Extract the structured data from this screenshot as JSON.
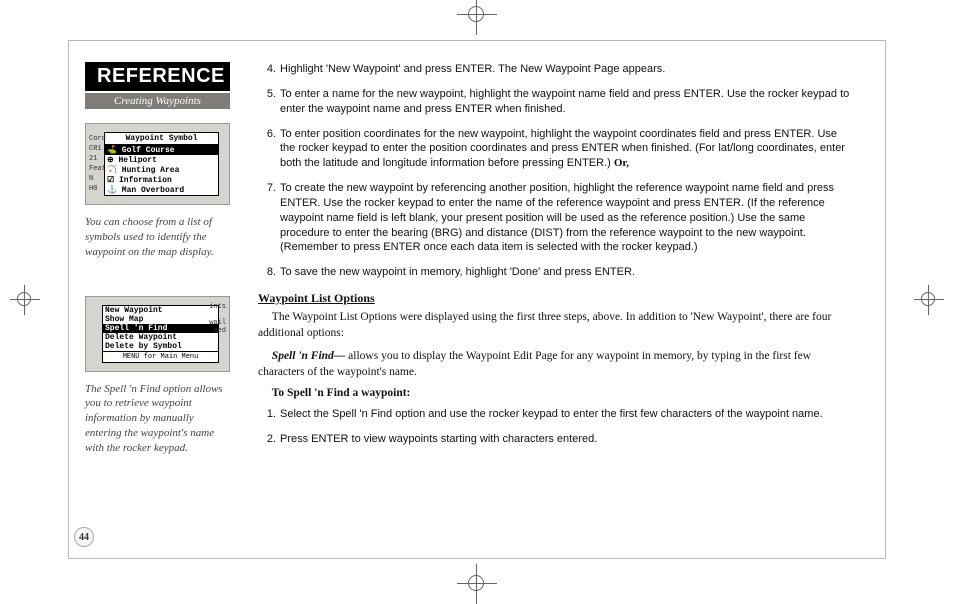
{
  "banner": "REFERENCE",
  "subhead": "Creating Waypoints",
  "screenshot1": {
    "title": "Waypoint Symbol",
    "sidetext": "Cord\nCR1\n21\nFeat\nN\nH0",
    "rows": [
      {
        "text": "⛳ Golf Course",
        "selected": true
      },
      {
        "text": "⊕ Heliport",
        "selected": false
      },
      {
        "text": "🏹 Hunting Area",
        "selected": false
      },
      {
        "text": "☑ Information",
        "selected": false
      },
      {
        "text": "⚓ Man Overboard",
        "selected": false
      }
    ]
  },
  "caption1": "You can choose from a list of symbols used to identify the waypoint on the map display.",
  "screenshot2": {
    "rows": [
      {
        "text": "New Waypoint",
        "selected": false
      },
      {
        "text": "Show Map",
        "selected": false
      },
      {
        "text": "Spell 'n Find",
        "selected": true
      },
      {
        "text": "Delete Waypoint",
        "selected": false
      },
      {
        "text": "Delete by Symbol",
        "selected": false
      }
    ],
    "footer": "MENU for Main Menu",
    "sideright": "ints\n\nwail\nsed"
  },
  "caption2": "The Spell 'n Find option allows you to retrieve waypoint information by manually entering the waypoint's name with the rocker keypad.",
  "steps": [
    {
      "n": "4.",
      "t": "Highlight 'New Waypoint' and press ENTER. The New Waypoint Page appears."
    },
    {
      "n": "5.",
      "t": "To enter a name for the new waypoint, highlight the waypoint name field and press ENTER. Use the rocker keypad to enter the waypoint name and press ENTER when finished."
    },
    {
      "n": "6.",
      "t": "To enter position coordinates for the new waypoint, highlight the waypoint coordinates field and press ENTER. Use the rocker keypad to enter the position coordinates and press ENTER when finished. (For lat/long coordinates, enter both the latitude and longitude information before pressing ENTER.) ",
      "or": "Or,"
    },
    {
      "n": "7.",
      "t": "To create the new waypoint by referencing another position, highlight the reference waypoint name field and press ENTER. Use the rocker keypad to enter the name of the reference waypoint and press ENTER. (If the reference waypoint name field is left blank, your present position will be used as the reference position.) Use the same procedure to enter the bearing (BRG) and distance (DIST) from the reference waypoint to the new waypoint. (Remember to press ENTER once each data item is selected with the rocker keypad.)"
    },
    {
      "n": "8.",
      "t": "To save the new waypoint in memory, highlight 'Done' and press ENTER."
    }
  ],
  "sectionTitle": "Waypoint List Options",
  "sectionBody1": "The Waypoint List Options were displayed using the first three steps, above. In addition to 'New Waypoint', there are four additional options:",
  "spellLead": "Spell 'n Find—",
  "spellBody": " allows you to display the Waypoint Edit Page for any waypoint in memory, by typing in the first few characters of the waypoint's name.",
  "procHead": "To Spell 'n Find a waypoint:",
  "procSteps": [
    {
      "n": "1.",
      "t": "Select the Spell 'n Find option and use the rocker keypad to enter the first few characters of the waypoint name."
    },
    {
      "n": "2.",
      "t": "Press ENTER to view waypoints starting with characters entered."
    }
  ],
  "pageNumber": "44"
}
